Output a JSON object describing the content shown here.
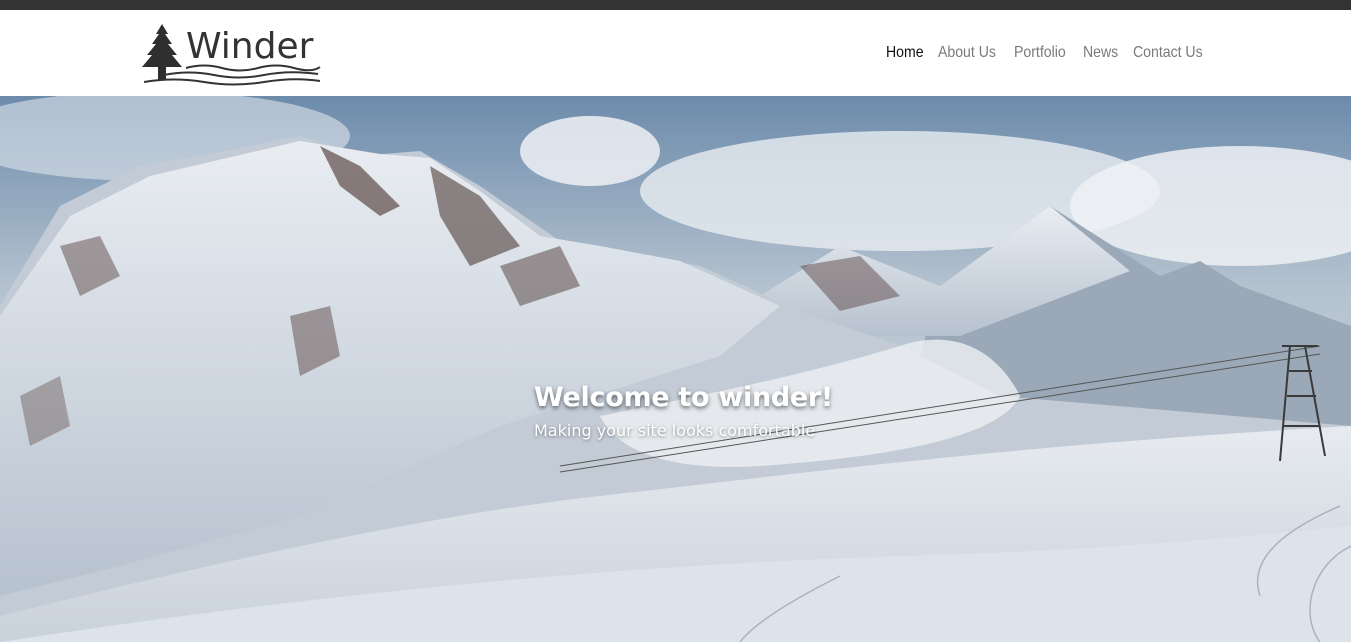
{
  "brand": {
    "name": "Winder",
    "logo_icon": "pine-tree-icon"
  },
  "nav": {
    "items": [
      {
        "label": "Home",
        "active": true
      },
      {
        "label": "About Us",
        "active": false
      },
      {
        "label": "Portfolio",
        "active": false
      },
      {
        "label": "News",
        "active": false
      },
      {
        "label": "Contact Us",
        "active": false
      }
    ]
  },
  "hero": {
    "title": "Welcome to winder!",
    "subtitle": "Making your site looks comfortable"
  },
  "colors": {
    "topbar": "#333333",
    "nav_active": "#111111",
    "nav_inactive": "#7a7a7a",
    "hero_text": "#ffffff"
  }
}
